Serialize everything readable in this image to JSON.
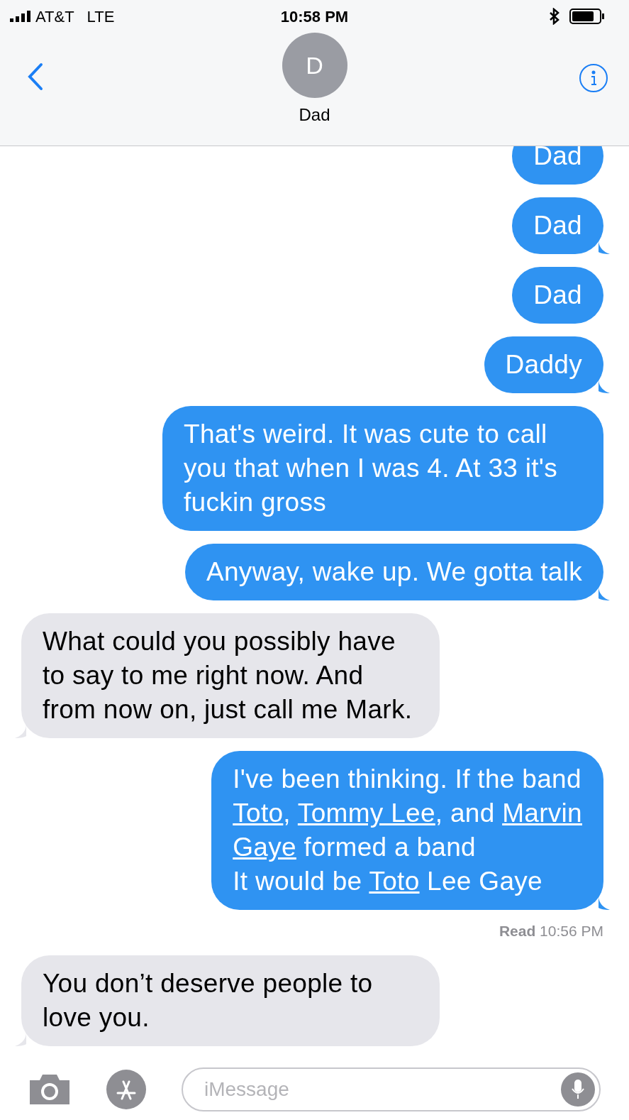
{
  "status_bar": {
    "carrier": "AT&T",
    "network": "LTE",
    "time": "10:58 PM"
  },
  "header": {
    "avatar_initial": "D",
    "contact_name": "Dad"
  },
  "messages": [
    {
      "kind": "sent",
      "text": "Dad",
      "tail": false,
      "cut": true
    },
    {
      "kind": "sent",
      "text": "Dad",
      "tail": true
    },
    {
      "kind": "sent",
      "text": "Dad",
      "tail": false
    },
    {
      "kind": "sent",
      "text": "Daddy",
      "tail": true
    },
    {
      "kind": "sent",
      "text": "That's weird. It was cute to call you that when I was 4. At 33 it's fuckin gross",
      "tail": false
    },
    {
      "kind": "sent",
      "text": "Anyway, wake up. We gotta talk",
      "tail": true
    },
    {
      "kind": "received",
      "text": "What could you possibly have to say to me right now. And from now on, just call me Mark.",
      "tail": true
    },
    {
      "kind": "sent",
      "tail": true,
      "lines": [
        [
          {
            "text": "I've been thinking. If the band",
            "link": false
          }
        ],
        [
          {
            "text": "Toto",
            "link": true
          },
          {
            "text": ", ",
            "link": false
          },
          {
            "text": "Tommy Lee",
            "link": true
          },
          {
            "text": ", and ",
            "link": false
          },
          {
            "text": "Marvin",
            "link": true
          }
        ],
        [
          {
            "text": "Gaye",
            "link": true
          },
          {
            "text": " formed a band",
            "link": false
          }
        ],
        [
          {
            "text": "It would be ",
            "link": false
          },
          {
            "text": "Toto",
            "link": true
          },
          {
            "text": " Lee Gaye",
            "link": false
          }
        ]
      ]
    },
    {
      "kind": "receipt",
      "label": "Read",
      "time": "10:56 PM"
    },
    {
      "kind": "received",
      "text": "You don’t deserve people to love you.",
      "tail": true
    }
  ],
  "composer": {
    "placeholder": "iMessage"
  }
}
